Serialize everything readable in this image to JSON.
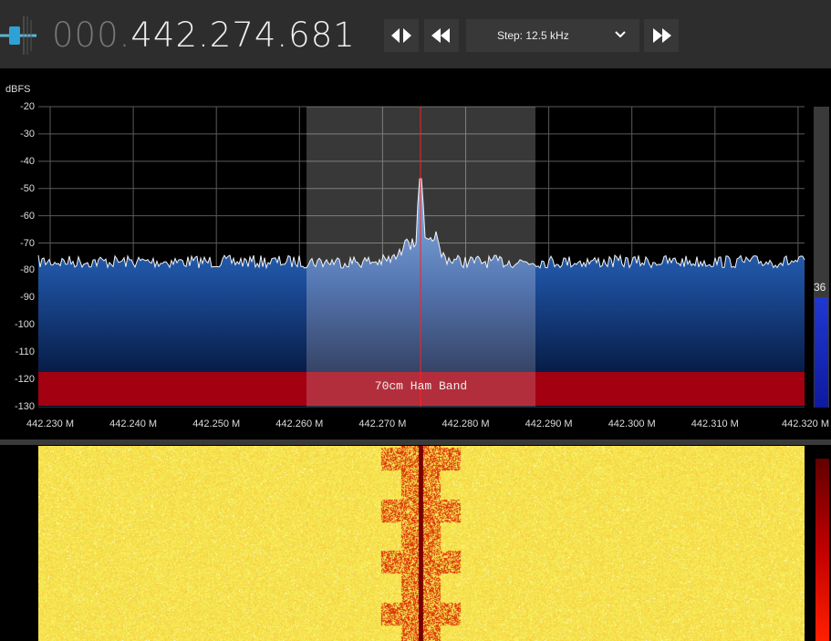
{
  "toolbar": {
    "frequency_dim": "000.",
    "frequency_bright": "442.274.681",
    "step_label": "Step: 12.5 kHz"
  },
  "icons": [
    "gain-slider-icon",
    "tune-arrows-icon",
    "rewind-icon",
    "chevron-down-icon",
    "fast-forward-icon"
  ],
  "spectrum": {
    "unit_label": "dBFS",
    "y_ticks": [
      "-20",
      "-30",
      "-40",
      "-50",
      "-60",
      "-70",
      "-80",
      "-90",
      "-100",
      "-110",
      "-120",
      "-130"
    ],
    "x_ticks": [
      "442.230 M",
      "442.240 M",
      "442.250 M",
      "442.260 M",
      "442.270 M",
      "442.280 M",
      "442.290 M",
      "442.300 M",
      "442.310 M",
      "442.320 M"
    ],
    "band_label": "70cm Ham Band",
    "level_readout": "36"
  },
  "colors": {
    "toolbar_bg": "#2d2d2d",
    "spectrum_fill_top": "#3b7fd0",
    "band_red": "#a30012",
    "tuning_line": "#ff2020",
    "waterfall_yellow": "#f6e23a",
    "waterfall_red": "#d61010"
  }
}
